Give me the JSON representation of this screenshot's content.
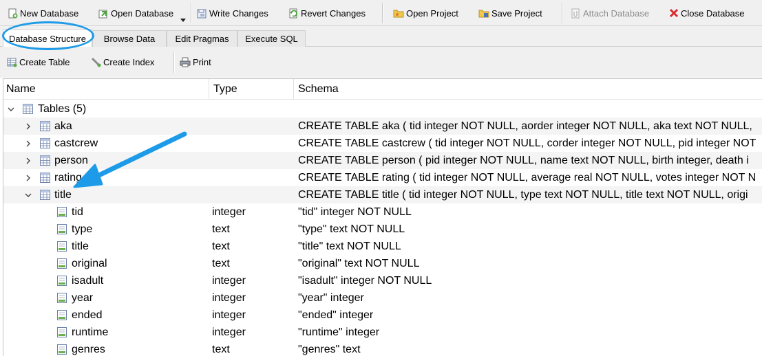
{
  "toolbar": {
    "new_database": "New Database",
    "open_database": "Open Database",
    "write_changes": "Write Changes",
    "revert_changes": "Revert Changes",
    "open_project": "Open Project",
    "save_project": "Save Project",
    "attach_database": "Attach Database",
    "close_database": "Close Database"
  },
  "tabs": [
    "Database Structure",
    "Browse Data",
    "Edit Pragmas",
    "Execute SQL"
  ],
  "structure_toolbar": {
    "create_table": "Create Table",
    "create_index": "Create Index",
    "print": "Print"
  },
  "tree": {
    "columns": [
      "Name",
      "Type",
      "Schema"
    ],
    "tables_group": "Tables (5)",
    "tables": [
      {
        "name": "aka",
        "schema": "CREATE TABLE aka ( tid integer NOT NULL, aorder integer NOT NULL, aka text NOT NULL,"
      },
      {
        "name": "castcrew",
        "schema": "CREATE TABLE castcrew ( tid integer NOT NULL, corder integer NOT NULL, pid integer NOT"
      },
      {
        "name": "person",
        "schema": "CREATE TABLE person ( pid integer NOT NULL, name text NOT NULL, birth integer, death i"
      },
      {
        "name": "rating",
        "schema": "CREATE TABLE rating ( tid integer NOT NULL, average real NOT NULL, votes integer NOT N"
      },
      {
        "name": "title",
        "schema": "CREATE TABLE title ( tid integer NOT NULL, type text NOT NULL, title text NOT NULL, origi"
      }
    ],
    "title_fields": [
      {
        "name": "tid",
        "type": "integer",
        "schema": "\"tid\" integer NOT NULL"
      },
      {
        "name": "type",
        "type": "text",
        "schema": "\"type\" text NOT NULL"
      },
      {
        "name": "title",
        "type": "text",
        "schema": "\"title\" text NOT NULL"
      },
      {
        "name": "original",
        "type": "text",
        "schema": "\"original\" text NOT NULL"
      },
      {
        "name": "isadult",
        "type": "integer",
        "schema": "\"isadult\" integer NOT NULL"
      },
      {
        "name": "year",
        "type": "integer",
        "schema": "\"year\" integer"
      },
      {
        "name": "ended",
        "type": "integer",
        "schema": "\"ended\" integer"
      },
      {
        "name": "runtime",
        "type": "integer",
        "schema": "\"runtime\" integer"
      },
      {
        "name": "genres",
        "type": "text",
        "schema": "\"genres\" text"
      }
    ]
  },
  "annotation": {
    "color": "#1e9be8"
  }
}
